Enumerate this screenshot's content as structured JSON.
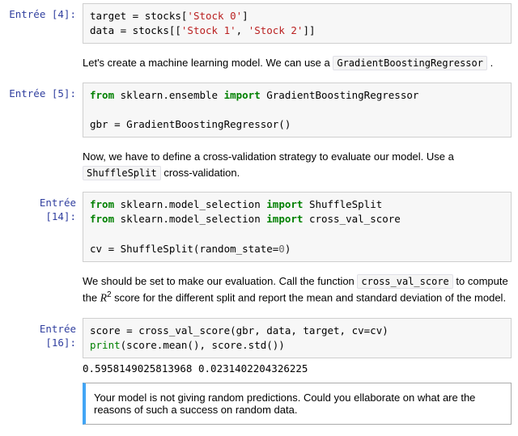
{
  "cells": {
    "c4": {
      "prompt": "Entrée [4]:",
      "code": {
        "l1": {
          "a": "target",
          "b": " = stocks[",
          "s": "'Stock 0'",
          "c": "]"
        },
        "l2": {
          "a": "data",
          "b": " = stocks[[",
          "s1": "'Stock 1'",
          "comma": ", ",
          "s2": "'Stock 2'",
          "c": "]]"
        }
      }
    },
    "m1": {
      "pre": "Let's create a machine learning model. We can use a ",
      "code": "GradientBoostingRegressor",
      "post": " ."
    },
    "c5": {
      "prompt": "Entrée [5]:",
      "code": {
        "l1": {
          "kw1": "from",
          "mod": " sklearn.ensemble ",
          "kw2": "import",
          "name": " GradientBoostingRegressor"
        },
        "l3": {
          "a": "gbr = GradientBoostingRegressor()"
        }
      }
    },
    "m2": {
      "pre": "Now, we have to define a cross-validation strategy to evaluate our model. Use a ",
      "code": "ShuffleSplit",
      "post": " cross-validation."
    },
    "c14": {
      "prompt": "Entrée [14]:",
      "code": {
        "l1": {
          "kw1": "from",
          "mod": " sklearn.model_selection ",
          "kw2": "import",
          "name": " ShuffleSplit"
        },
        "l2": {
          "kw1": "from",
          "mod": " sklearn.model_selection ",
          "kw2": "import",
          "name": " cross_val_score"
        },
        "l4": {
          "a": "cv = ShuffleSplit(random_state=",
          "num": "0",
          "b": ")"
        }
      }
    },
    "m3": {
      "pre": "We should be set to make our evaluation. Call the function ",
      "code": "cross_val_score",
      "mid": " to compute the ",
      "math": "R",
      "sup": "2",
      "post": " score for the different split and report the mean and standard deviation of the model."
    },
    "c16": {
      "prompt": "Entrée [16]:",
      "code": {
        "l1": {
          "a": "score = cross_val_score(gbr, data, target, cv=cv)"
        },
        "l2": {
          "pr": "print",
          "a": "(score.mean(), score.std())"
        }
      },
      "output": "0.5958149025813968 0.0231402204326225"
    },
    "m4": {
      "text": "Your model is not giving random predictions. Could you ellaborate on what are the reasons of such a success on random data."
    }
  }
}
